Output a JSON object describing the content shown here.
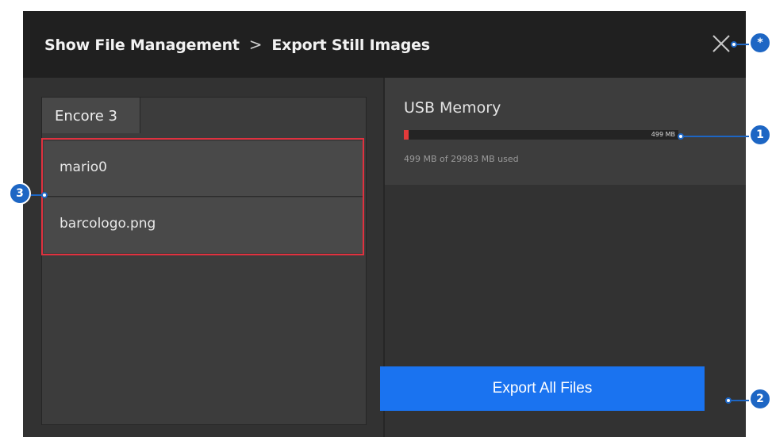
{
  "header": {
    "breadcrumb_root": "Show File Management",
    "separator": ">",
    "breadcrumb_current": "Export Still Images"
  },
  "tab": {
    "label": "Encore 3"
  },
  "files": [
    {
      "name": "mario0"
    },
    {
      "name": "barcologo.png"
    }
  ],
  "storage": {
    "title": "USB Memory",
    "used_label": "499 MB",
    "summary": "499 MB of 29983 MB used",
    "used_mb": 499,
    "total_mb": 29983
  },
  "export_button": {
    "label": "Export All Files"
  },
  "callouts": {
    "close": "*",
    "storage_bar": "1",
    "export": "2",
    "file_list": "3"
  },
  "colors": {
    "accent": "#1a73f0",
    "highlight": "#e0313f",
    "usage_bar": "#e33a3a",
    "callout": "#1d66c4"
  },
  "icons": {
    "close": "close-icon",
    "separator": "chevron-right"
  }
}
